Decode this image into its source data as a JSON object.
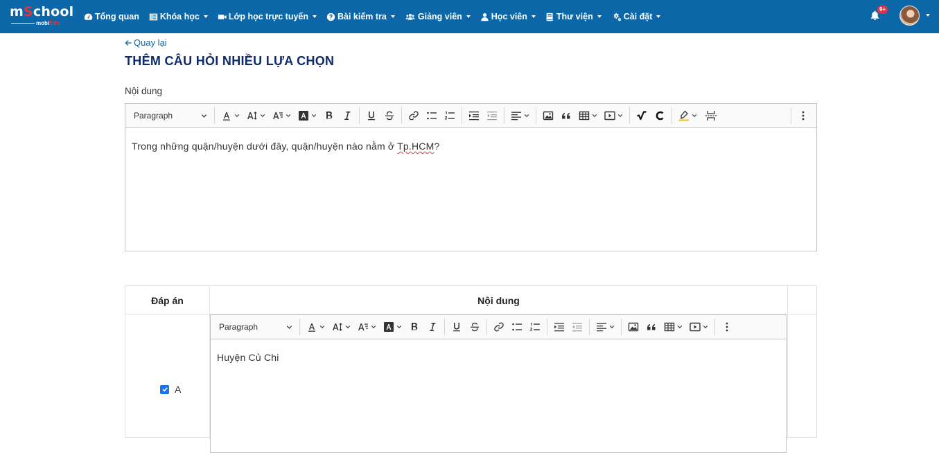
{
  "brand": {
    "main_prefix": "m",
    "main_o": "S",
    "main_suffix": "chool",
    "sub_prefix": "mobi",
    "sub_suffix": "Edu"
  },
  "nav": {
    "items": [
      {
        "label": "Tổng quan",
        "icon": "dashboard-icon",
        "dropdown": false
      },
      {
        "label": "Khóa học",
        "icon": "list-icon",
        "dropdown": true
      },
      {
        "label": "Lớp học trực tuyến",
        "icon": "video-icon",
        "dropdown": true
      },
      {
        "label": "Bài kiểm tra",
        "icon": "question-circle-icon",
        "dropdown": true
      },
      {
        "label": "Giảng viên",
        "icon": "users-icon",
        "dropdown": true
      },
      {
        "label": "Học viên",
        "icon": "user-icon",
        "dropdown": true
      },
      {
        "label": "Thư viện",
        "icon": "book-icon",
        "dropdown": true
      },
      {
        "label": "Cài đặt",
        "icon": "gears-icon",
        "dropdown": true
      }
    ],
    "notification_badge": "9+"
  },
  "page": {
    "back_label": "Quay lại",
    "title": "THÊM CÂU HỎI NHIỀU LỰA CHỌN",
    "content_label": "Nội dung"
  },
  "toolbar": {
    "paragraph_label": "Paragraph"
  },
  "question": {
    "text_before": "Trong những quận/huyện dưới đây, quận/huyện nào nằm ở ",
    "text_spell": "Tp.HCM",
    "text_after": "?"
  },
  "answers_table": {
    "col_answer": "Đáp án",
    "col_content": "Nội dung",
    "rows": [
      {
        "letter": "A",
        "checked": true,
        "content": "Huyện Củ Chi"
      }
    ]
  },
  "colors": {
    "navbar": "#0b67a8",
    "title": "#0d2b6b",
    "link": "#0b67a8",
    "checkbox": "#1a73e8",
    "badge": "#dc3545"
  }
}
